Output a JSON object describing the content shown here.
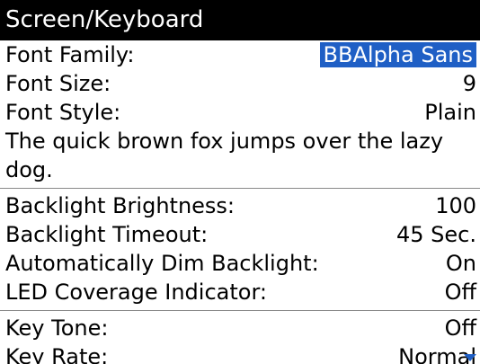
{
  "title": "Screen/Keyboard",
  "font": {
    "family_label": "Font Family:",
    "family_value": "BBAlpha Sans",
    "size_label": "Font Size:",
    "size_value": "9",
    "style_label": "Font Style:",
    "style_value": "Plain",
    "sample": "The quick brown fox jumps over the lazy dog."
  },
  "backlight": {
    "brightness_label": "Backlight Brightness:",
    "brightness_value": "100",
    "timeout_label": "Backlight Timeout:",
    "timeout_value": "45 Sec.",
    "autodim_label": "Automatically Dim Backlight:",
    "autodim_value": "On",
    "led_label": "LED Coverage Indicator:",
    "led_value": "Off"
  },
  "keys": {
    "tone_label": "Key Tone:",
    "tone_value": "Off",
    "rate_label": "Key Rate:",
    "rate_value": "Normal"
  },
  "icons": {
    "scroll_hint": "scroll-down-arrow-icon"
  },
  "colors": {
    "selection": "#1f5fc5",
    "titlebar": "#000000"
  }
}
